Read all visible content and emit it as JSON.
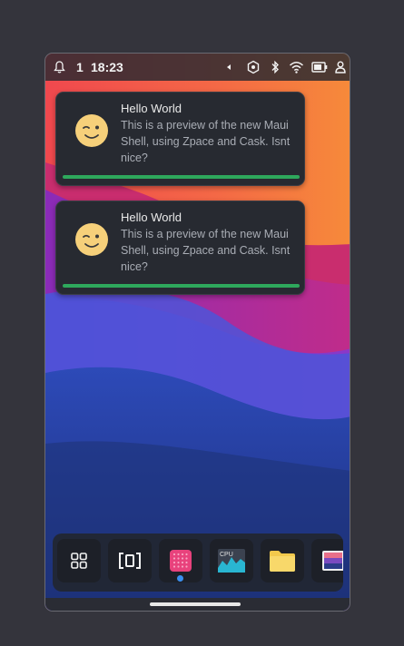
{
  "statusbar": {
    "notification_count": "1",
    "time": "18:23",
    "icons": [
      "bell-icon",
      "arrow-left-icon",
      "hexagon-icon",
      "bluetooth-icon",
      "wifi-icon",
      "battery-icon",
      "user-icon"
    ]
  },
  "notifications": [
    {
      "title": "Hello World",
      "body": "This is a preview of the new Maui Shell, using Zpace and Cask. Isnt nice?",
      "icon": "wink-emoji-icon",
      "progress": 1.0
    },
    {
      "title": "Hello World",
      "body": "This is a preview of the new Maui Shell, using Zpace and Cask. Isnt nice?",
      "icon": "wink-emoji-icon",
      "progress": 1.0
    }
  ],
  "dock": {
    "items": [
      {
        "name": "app-grid",
        "icon": "grid-icon"
      },
      {
        "name": "overview",
        "icon": "brackets-icon"
      },
      {
        "name": "app-pink",
        "icon": "pink-app-icon",
        "running": true
      },
      {
        "name": "system-monitor",
        "icon": "cpu-monitor-icon",
        "label": "CPU"
      },
      {
        "name": "files",
        "icon": "folder-icon"
      },
      {
        "name": "image-viewer",
        "icon": "image-icon"
      }
    ]
  },
  "colors": {
    "accent": "#3a8ff0",
    "progress": "#2ea85c",
    "panel": "#272a31"
  }
}
